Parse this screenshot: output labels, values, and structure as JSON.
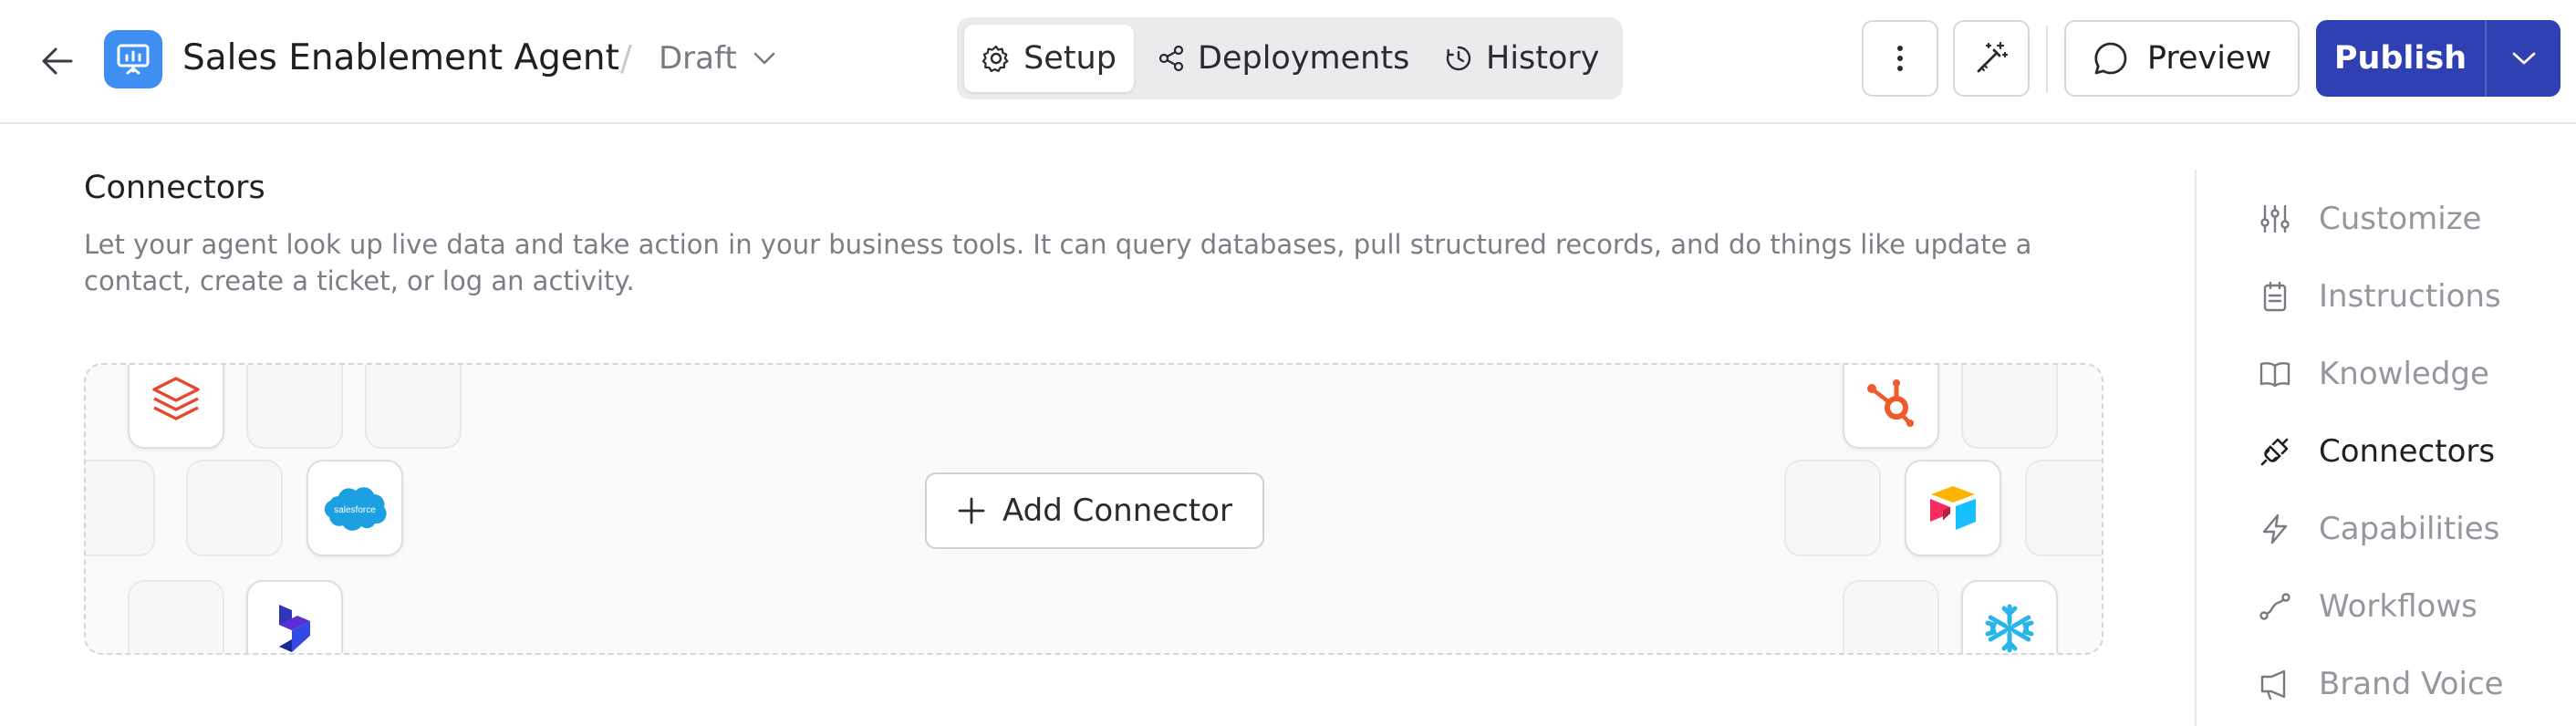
{
  "header": {
    "title": "Sales Enablement Agent",
    "separator": "/",
    "status": "Draft",
    "tabs": [
      {
        "label": "Setup",
        "icon": "gear-icon",
        "active": true
      },
      {
        "label": "Deployments",
        "icon": "share-nodes-icon",
        "active": false
      },
      {
        "label": "History",
        "icon": "history-icon",
        "active": false
      }
    ],
    "preview_label": "Preview",
    "publish_label": "Publish"
  },
  "section": {
    "title": "Connectors",
    "description": "Let your agent look up live data and take action in your business tools. It can query databases, pull structured records, and do things like update a contact, create a ticket, or log an activity.",
    "add_label": "Add Connector"
  },
  "connectors": [
    {
      "name": "Databricks",
      "icon": "databricks-logo-icon"
    },
    {
      "name": "Salesforce",
      "icon": "salesforce-logo-icon",
      "logo_text": "salesforce"
    },
    {
      "name": "Microsoft Dynamics",
      "icon": "dynamics-logo-icon"
    },
    {
      "name": "HubSpot",
      "icon": "hubspot-logo-icon"
    },
    {
      "name": "Airtable",
      "icon": "airtable-logo-icon"
    },
    {
      "name": "Snowflake",
      "icon": "snowflake-logo-icon"
    }
  ],
  "sidebar": {
    "items": [
      {
        "label": "Customize",
        "icon": "sliders-icon",
        "active": false
      },
      {
        "label": "Instructions",
        "icon": "clipboard-icon",
        "active": false
      },
      {
        "label": "Knowledge",
        "icon": "book-icon",
        "active": false
      },
      {
        "label": "Connectors",
        "icon": "plug-icon",
        "active": true
      },
      {
        "label": "Capabilities",
        "icon": "lightning-icon",
        "active": false
      },
      {
        "label": "Workflows",
        "icon": "workflow-icon",
        "active": false
      },
      {
        "label": "Brand Voice",
        "icon": "megaphone-icon",
        "active": false
      }
    ]
  },
  "colors": {
    "accent": "#2f40b3",
    "app_icon": "#3f8ff3",
    "text_primary": "#1f1f24",
    "text_muted": "#96969e"
  }
}
